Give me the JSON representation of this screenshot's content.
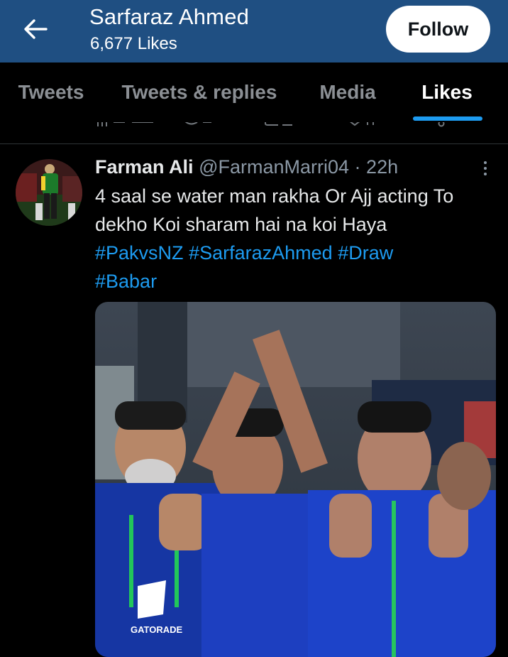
{
  "header": {
    "title": "Sarfaraz Ahmed",
    "likes_count": "6,677 Likes",
    "follow_label": "Follow",
    "back_icon": "arrow-left-icon",
    "bg_color": "#1f4f82"
  },
  "tabs": [
    {
      "label": "Tweets",
      "active": false
    },
    {
      "label": "Tweets & replies",
      "active": false
    },
    {
      "label": "Media",
      "active": false
    },
    {
      "label": "Likes",
      "active": true
    }
  ],
  "accent_color": "#1d9bf0",
  "tweet": {
    "author_name": "Farman Ali",
    "author_handle": "@FarmanMarri04",
    "separator": "·",
    "time": "22h",
    "text_lines": [
      "4 saal se water man rakha Or Ajj acting To",
      "dekho Koi sharam hai na koi Haya"
    ],
    "hashtags_line1": [
      "#PakvsNZ",
      "#SarfarazAhmed",
      "#Draw"
    ],
    "hashtags_line2": [
      "#Babar"
    ],
    "media_text": "GATORADE",
    "more_icon": "more-vertical-icon"
  }
}
